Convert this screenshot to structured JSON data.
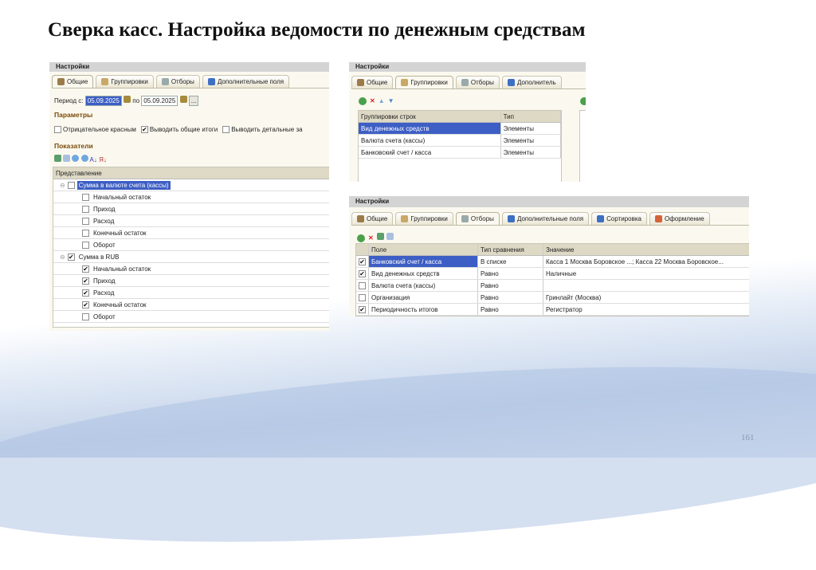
{
  "slide": {
    "title": "Сверка касс. Настройка ведомости по денежным средствам",
    "page_number": "161"
  },
  "panel1": {
    "title": "Настройки",
    "tabs": [
      "Общие",
      "Группировки",
      "Отборы",
      "Дополнительные поля"
    ],
    "active_tab": "Общие",
    "period_label": "Период с:",
    "period_from": "05.09.2025",
    "period_to_label": "по",
    "period_to": "05.09.2025",
    "more_button": "...",
    "params_header": "Параметры",
    "params": [
      {
        "label": "Отрицательное красным",
        "checked": false
      },
      {
        "label": "Выводить общие итоги",
        "checked": true
      },
      {
        "label": "Выводить детальные за",
        "checked": false
      }
    ],
    "indicators_header": "Показатели",
    "column": "Представление",
    "rows": [
      {
        "label": "Сумма в валюте счета (кассы)",
        "checked": false,
        "level": 0,
        "selected": true
      },
      {
        "label": "Начальный остаток",
        "checked": false,
        "level": 1
      },
      {
        "label": "Приход",
        "checked": false,
        "level": 1
      },
      {
        "label": "Расход",
        "checked": false,
        "level": 1
      },
      {
        "label": "Конечный остаток",
        "checked": false,
        "level": 1
      },
      {
        "label": "Оборот",
        "checked": false,
        "level": 1
      },
      {
        "label": "Сумма в RUB",
        "checked": true,
        "level": 0
      },
      {
        "label": "Начальный остаток",
        "checked": true,
        "level": 1
      },
      {
        "label": "Приход",
        "checked": true,
        "level": 1
      },
      {
        "label": "Расход",
        "checked": true,
        "level": 1
      },
      {
        "label": "Конечный остаток",
        "checked": true,
        "level": 1
      },
      {
        "label": "Оборот",
        "checked": false,
        "level": 1
      }
    ]
  },
  "panel2": {
    "title": "Настройки",
    "tabs": [
      "Общие",
      "Группировки",
      "Отборы",
      "Дополнитель"
    ],
    "active_tab": "Группировки",
    "columns": [
      "Группировки строк",
      "Тип"
    ],
    "rows": [
      [
        "Вид денежных средств",
        "Элементы"
      ],
      [
        "Валюта счета (кассы)",
        "Элементы"
      ],
      [
        "Банковский счет / касса",
        "Элементы"
      ]
    ]
  },
  "panel3": {
    "title": "Настройки",
    "tabs": [
      "Общие",
      "Группировки",
      "Отборы",
      "Дополнительные поля",
      "Сортировка",
      "Оформление"
    ],
    "active_tab": "Отборы",
    "columns": [
      "Поле",
      "Тип сравнения",
      "Значение"
    ],
    "rows": [
      {
        "checked": true,
        "field": "Банковский счет / касса",
        "cmp": "В списке",
        "value": "Касса 1 Москва Боровское ...; Касса 22 Москва Боровское..."
      },
      {
        "checked": true,
        "field": "Вид денежных средств",
        "cmp": "Равно",
        "value": "Наличные"
      },
      {
        "checked": false,
        "field": "Валюта счета (кассы)",
        "cmp": "Равно",
        "value": ""
      },
      {
        "checked": false,
        "field": "Организация",
        "cmp": "Равно",
        "value": "Гринлайт (Москва)"
      },
      {
        "checked": true,
        "field": "Периодичность итогов",
        "cmp": "Равно",
        "value": "Регистратор"
      }
    ]
  },
  "colors": {
    "selection": "#3d5ec4",
    "section_header": "#7b4a0b",
    "panel_bg": "#fbf9ef"
  }
}
